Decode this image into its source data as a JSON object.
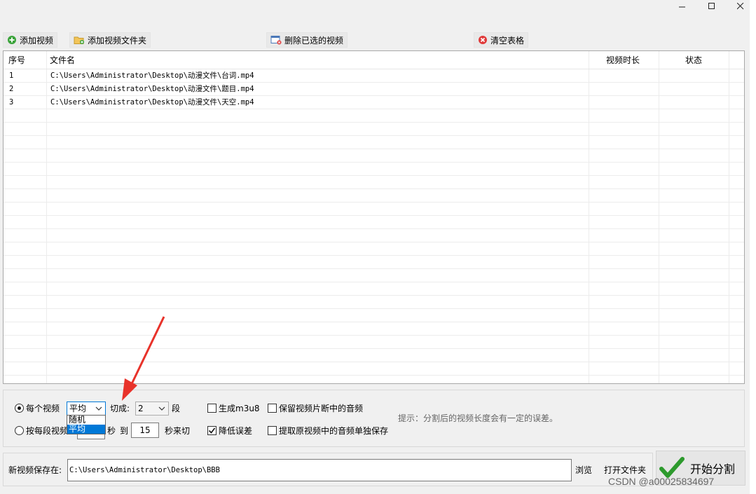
{
  "window": {
    "controls": [
      "minimize-icon",
      "maximize-icon",
      "close-icon"
    ]
  },
  "toolbar": {
    "add_video": "添加视频",
    "add_folder": "添加视频文件夹",
    "delete_selected": "删除已选的视频",
    "clear_table": "清空表格"
  },
  "table": {
    "headers": [
      "序号",
      "文件名",
      "视频时长",
      "状态"
    ],
    "rows": [
      {
        "index": "1",
        "filename": "C:\\Users\\Administrator\\Desktop\\动漫文件\\台词.mp4",
        "duration": "",
        "status": ""
      },
      {
        "index": "2",
        "filename": "C:\\Users\\Administrator\\Desktop\\动漫文件\\题目.mp4",
        "duration": "",
        "status": ""
      },
      {
        "index": "3",
        "filename": "C:\\Users\\Administrator\\Desktop\\动漫文件\\天空.mp4",
        "duration": "",
        "status": ""
      }
    ]
  },
  "options": {
    "mode_each_video": "每个视频",
    "mode_segment": "按每段视频",
    "split_method_value": "平均",
    "split_method_options": [
      "随机",
      "平均"
    ],
    "cut_into_label": "切成:",
    "segments_value": "2",
    "segments_unit": "段",
    "seconds_label": "秒",
    "to_label": "到",
    "seconds_to_value": "15",
    "seconds_cut_label": "秒来切",
    "generate_m3u8": "生成m3u8",
    "reduce_error": "降低误差",
    "keep_audio": "保留视频片断中的音频",
    "extract_audio": "提取原视频中的音频单独保存",
    "hint": "提示：分割后的视频长度会有一定的误差。"
  },
  "save": {
    "label": "新视频保存在:",
    "path": "C:\\Users\\Administrator\\Desktop\\BBB",
    "browse": "浏览",
    "open_folder": "打开文件夹",
    "start": "开始分割"
  },
  "watermark": "CSDN @a00025834697",
  "colors": {
    "selection_blue": "#0078d7",
    "annotation_red": "#e8322a",
    "check_green": "#2d9a2d"
  }
}
